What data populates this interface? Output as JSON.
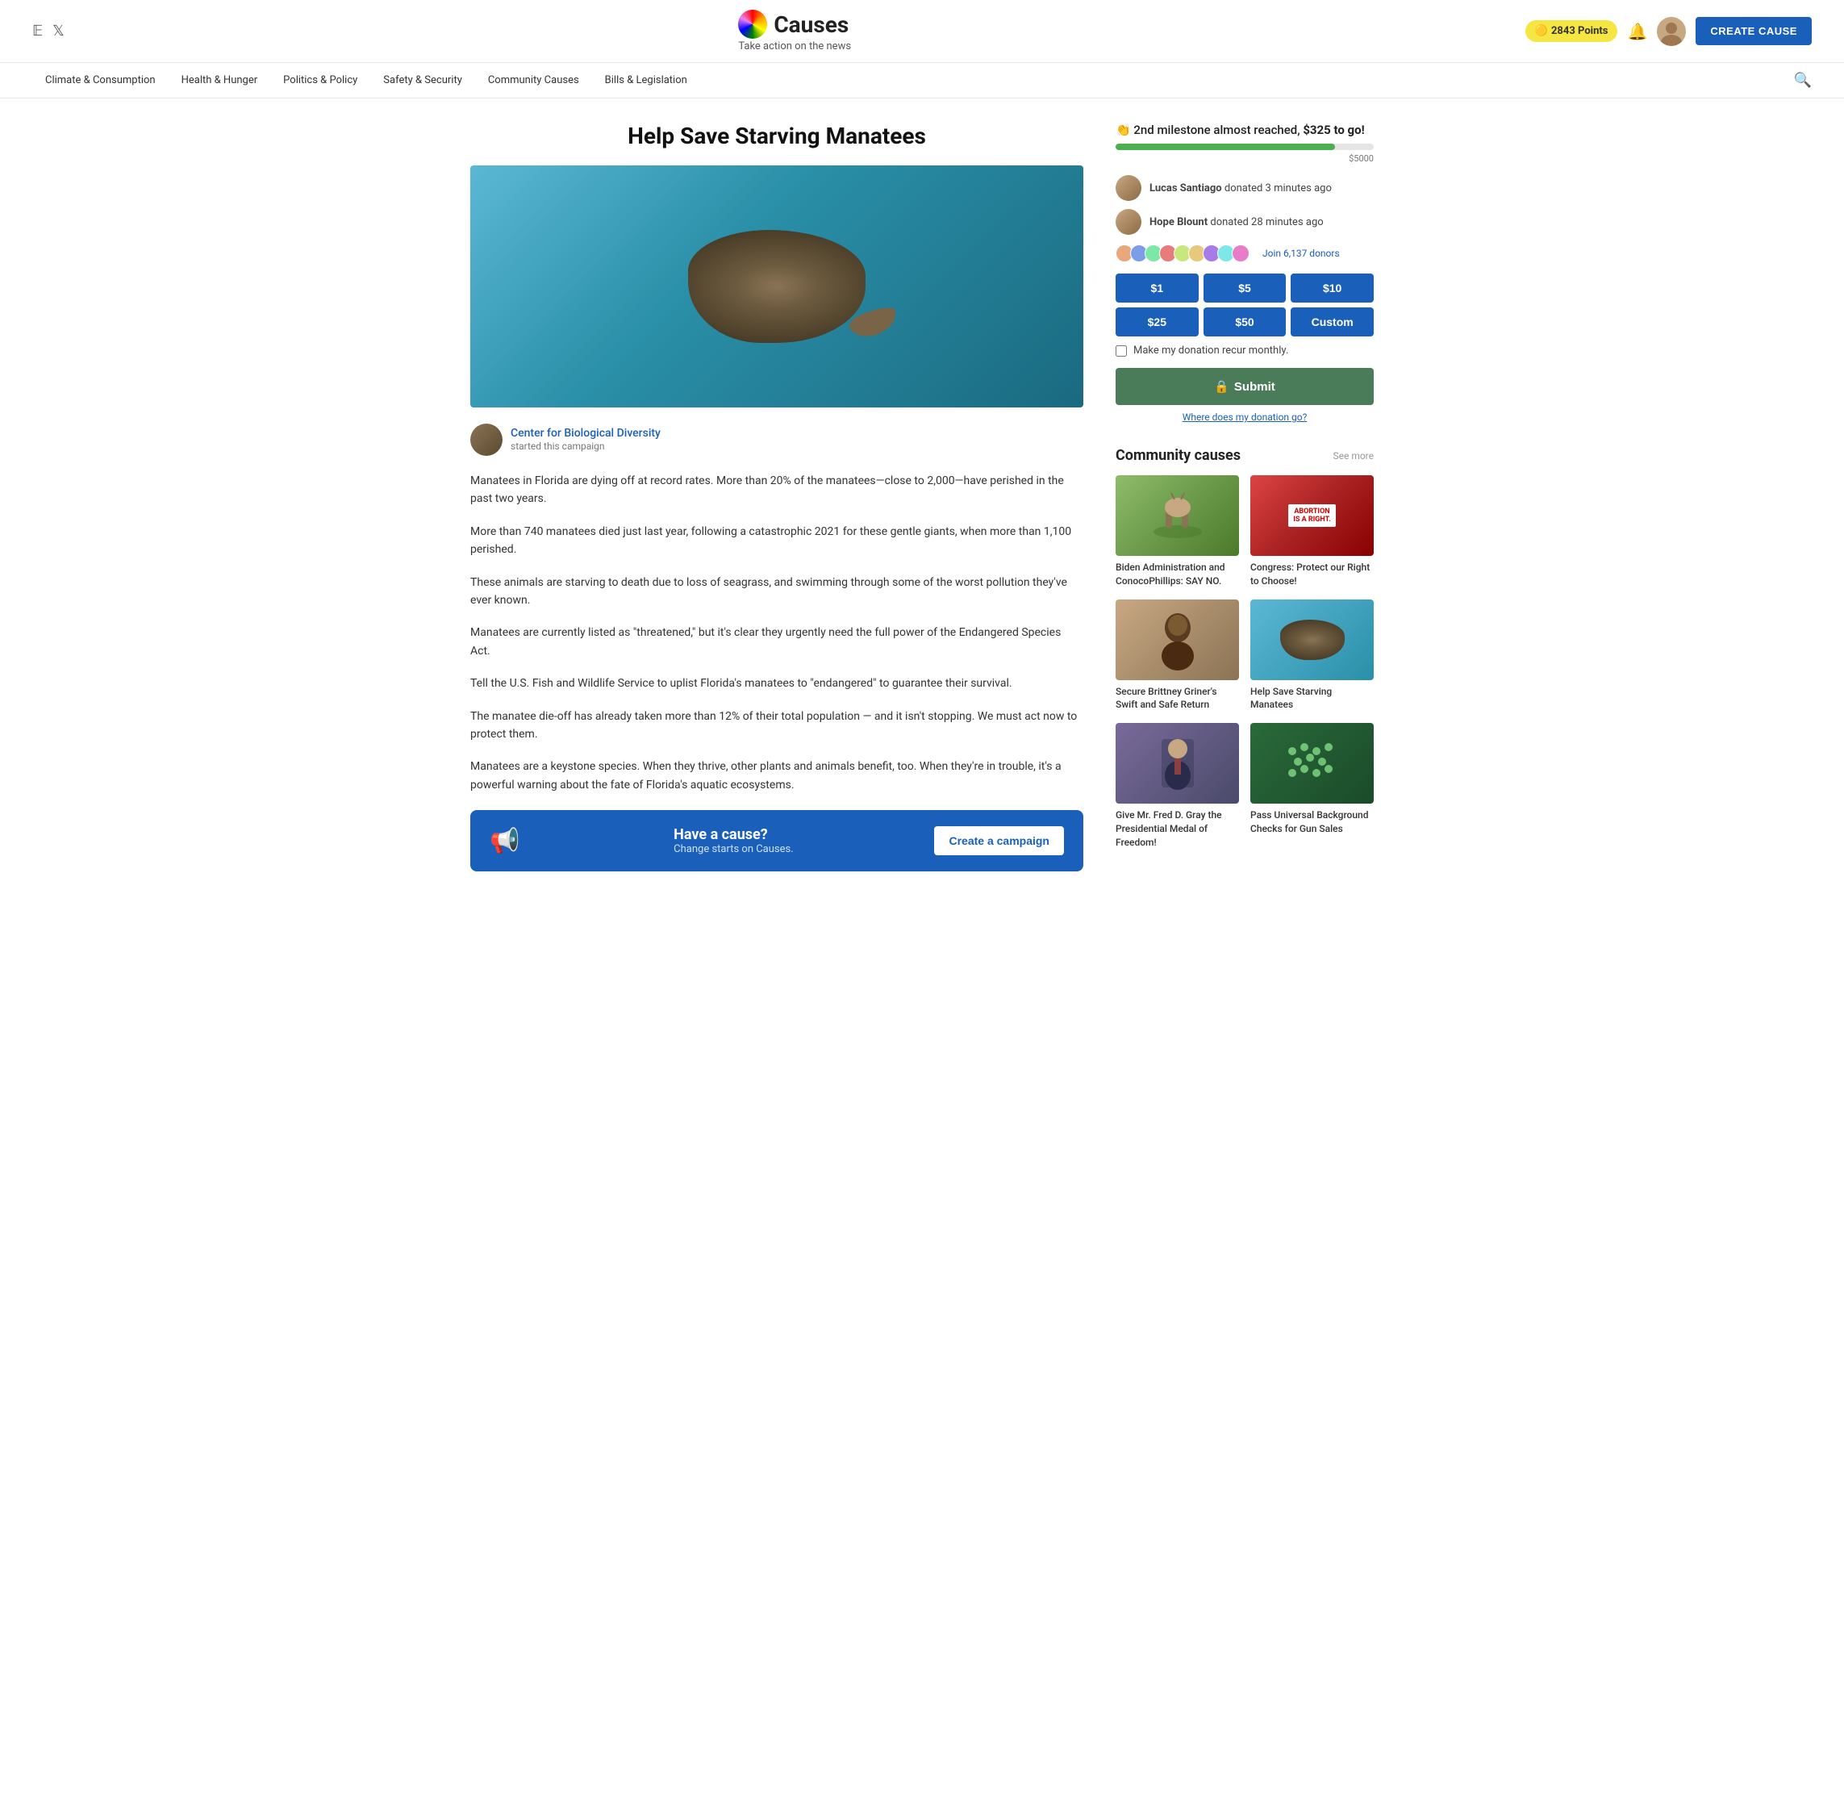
{
  "header": {
    "logo_text": "Causes",
    "tagline": "Take action on the news",
    "points": "2843 Points",
    "create_btn": "CREATE CAUSE"
  },
  "nav": {
    "items": [
      "Climate & Consumption",
      "Health & Hunger",
      "Politics & Policy",
      "Safety & Security",
      "Community Causes",
      "Bills & Legislation"
    ]
  },
  "article": {
    "title": "Help Save Starving Manatees",
    "author_name": "Center for Biological Diversity",
    "author_sub": "started this campaign",
    "body": [
      "Manatees in Florida are dying off at record rates. More than 20% of the manatees—close to 2,000—have perished in the past two years.",
      "More than 740 manatees died just last year, following a catastrophic 2021 for these gentle giants, when more than 1,100 perished.",
      "These animals are starving to death due to loss of seagrass, and swimming through some of the worst pollution they've ever known.",
      "Manatees are currently listed as \"threatened,\" but it's clear they urgently need the full power of the Endangered Species Act.",
      "Tell the U.S. Fish and Wildlife Service to uplist Florida's manatees to \"endangered\" to guarantee their survival.",
      "The manatee die-off has already taken more than 12% of their total population — and it isn't stopping. We must act now to protect them.",
      "Manatees are a keystone species. When they thrive, other plants and animals benefit, too. When they're in trouble, it's a powerful warning about the fate of Florida's aquatic ecosystems."
    ]
  },
  "cta": {
    "title": "Have a cause?",
    "subtitle": "Change starts on Causes.",
    "btn": "Create a campaign"
  },
  "donation": {
    "milestone_text": "2nd milestone almost reached,",
    "milestone_amount": "$325 to go!",
    "goal": "$5000",
    "progress_pct": 85,
    "donors": [
      {
        "name": "Lucas Santiago",
        "time": "donated 3 minutes ago"
      },
      {
        "name": "Hope Blount",
        "time": "donated 28 minutes ago"
      }
    ],
    "join_donors_text": "Join 6,137 donors",
    "amounts": [
      "$1",
      "$5",
      "$10",
      "$25",
      "$50",
      "Custom"
    ],
    "recur_label": "Make my donation recur monthly.",
    "submit_label": "Submit",
    "where_link": "Where does my donation go?"
  },
  "community": {
    "title": "Community causes",
    "see_more": "See more",
    "causes": [
      {
        "caption": "Biden Administration and ConocoPhillips: SAY NO.",
        "thumb_class": "thumb-deer"
      },
      {
        "caption": "Congress: Protect our Right to Choose!",
        "thumb_class": "thumb-abortion",
        "label": "ABORTION IS A RIGHT."
      },
      {
        "caption": "Secure Brittney Griner's Swift and Safe Return",
        "thumb_class": "thumb-brittney"
      },
      {
        "caption": "Help Save Starving Manatees",
        "thumb_class": "thumb-manatee"
      },
      {
        "caption": "Give Mr. Fred D. Gray the Presidential Medal of Freedom!",
        "thumb_class": "thumb-gray"
      },
      {
        "caption": "Pass Universal Background Checks for Gun Sales",
        "thumb_class": "thumb-gun"
      }
    ]
  }
}
